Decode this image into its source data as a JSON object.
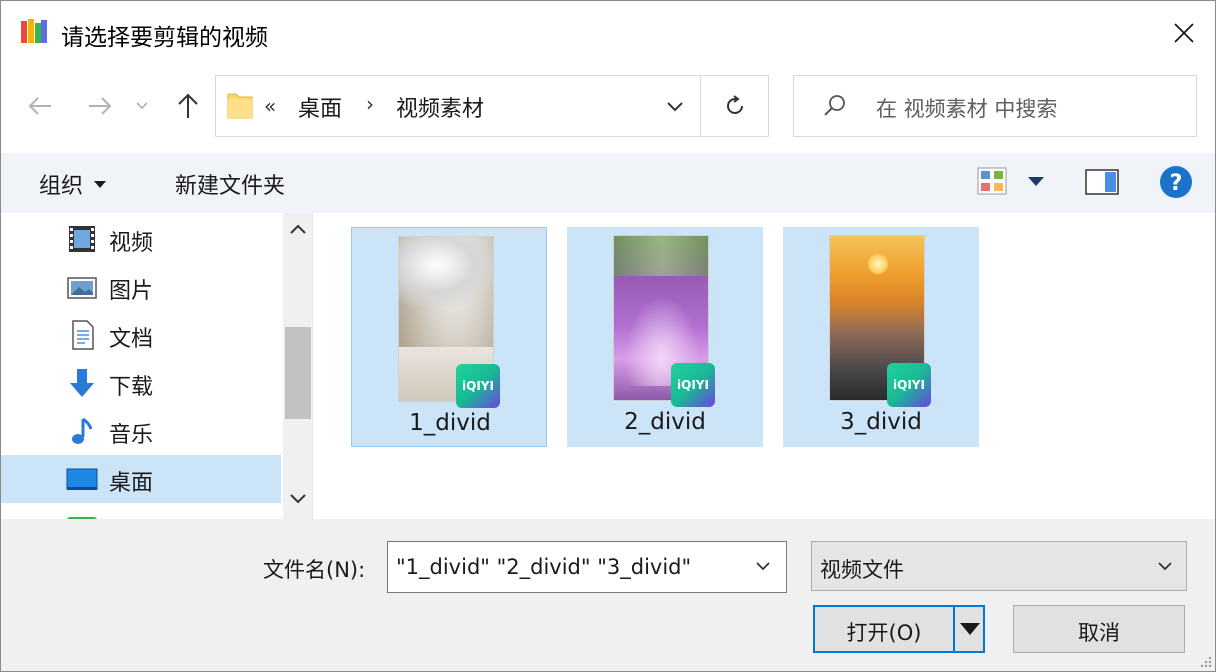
{
  "title": "请选择要剪辑的视频",
  "address": {
    "overflow": "«",
    "crumbs": [
      "桌面",
      "视频素材"
    ],
    "separator": "›"
  },
  "search": {
    "placeholder": "在 视频素材 中搜索"
  },
  "toolbar": {
    "organize_label": "组织",
    "new_folder_label": "新建文件夹"
  },
  "sidebar": {
    "items": [
      {
        "label": "视频",
        "icon": "video-icon"
      },
      {
        "label": "图片",
        "icon": "pictures-icon"
      },
      {
        "label": "文档",
        "icon": "documents-icon"
      },
      {
        "label": "下载",
        "icon": "download-icon"
      },
      {
        "label": "音乐",
        "icon": "music-icon"
      },
      {
        "label": "桌面",
        "icon": "desktop-icon",
        "selected": true
      }
    ]
  },
  "files": [
    {
      "name": "1_divid",
      "badge": "iQIYI",
      "selected": true,
      "focused": true
    },
    {
      "name": "2_divid",
      "badge": "iQIYI",
      "selected": true
    },
    {
      "name": "3_divid",
      "badge": "iQIYI",
      "selected": true
    }
  ],
  "bottom": {
    "filename_label": "文件名(N):",
    "filename_value": "\"1_divid\" \"2_divid\" \"3_divid\"",
    "filetype_value": "视频文件",
    "open_label": "打开(O)",
    "cancel_label": "取消"
  },
  "colors": {
    "accent": "#0078d7",
    "selection": "#cce4f7",
    "commandbar": "#f0f4f9",
    "help": "#1a73c8"
  }
}
